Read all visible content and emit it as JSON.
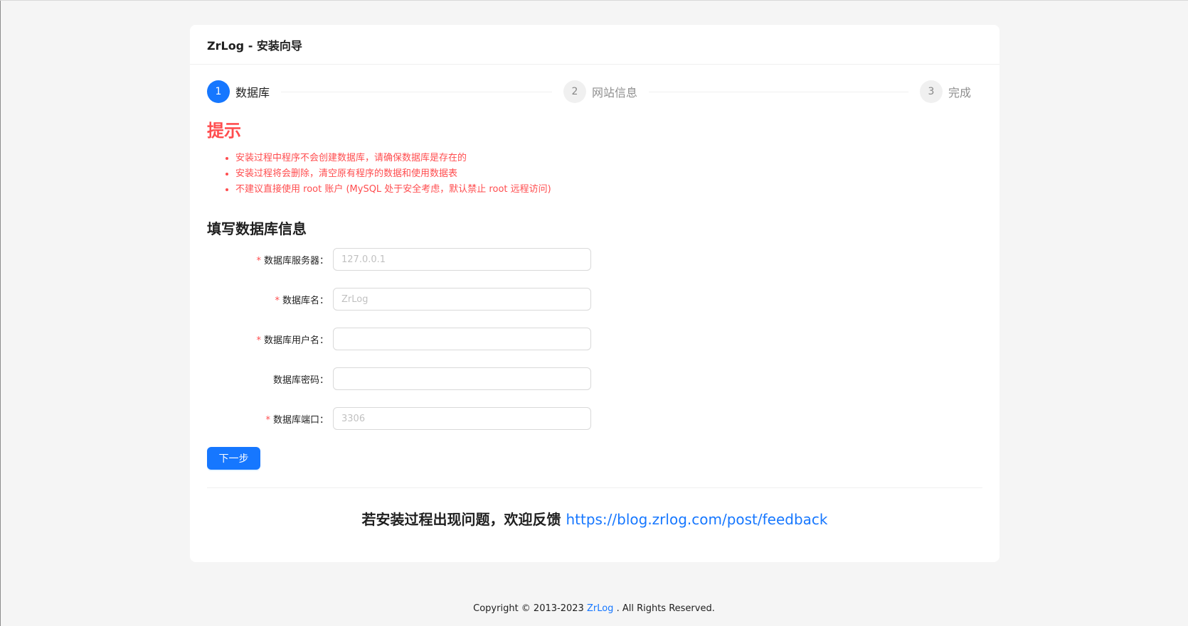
{
  "header": {
    "title": "ZrLog - 安装向导"
  },
  "steps": [
    {
      "number": "1",
      "title": "数据库",
      "status": "active"
    },
    {
      "number": "2",
      "title": "网站信息",
      "status": "wait"
    },
    {
      "number": "3",
      "title": "完成",
      "status": "wait"
    }
  ],
  "tips": {
    "title": "提示",
    "items": [
      "安装过程中程序不会创建数据库，请确保数据库是存在的",
      "安装过程将会删除，清空原有程序的数据和使用数据表",
      "不建议直接使用 root 账户 (MySQL 处于安全考虑，默认禁止 root 远程访问)"
    ]
  },
  "form": {
    "section_title": "填写数据库信息",
    "required_mark": "*",
    "fields": [
      {
        "label": "数据库服务器：",
        "required": true,
        "placeholder": "127.0.0.1",
        "value": ""
      },
      {
        "label": "数据库名：",
        "required": true,
        "placeholder": "ZrLog",
        "value": ""
      },
      {
        "label": "数据库用户名：",
        "required": true,
        "placeholder": "",
        "value": ""
      },
      {
        "label": "数据库密码：",
        "required": false,
        "placeholder": "",
        "value": ""
      },
      {
        "label": "数据库端口：",
        "required": true,
        "placeholder": "3306",
        "value": ""
      }
    ],
    "next_button": "下一步"
  },
  "feedback": {
    "text": "若安装过程出现问题，欢迎反馈",
    "link_text": "https://blog.zrlog.com/post/feedback"
  },
  "footer": {
    "prefix": "Copyright © 2013-2023",
    "link_text": "ZrLog",
    "suffix": ". All Rights Reserved."
  },
  "colors": {
    "primary": "#1677ff",
    "error": "#ff4d4f",
    "background": "#f5f5f5"
  }
}
